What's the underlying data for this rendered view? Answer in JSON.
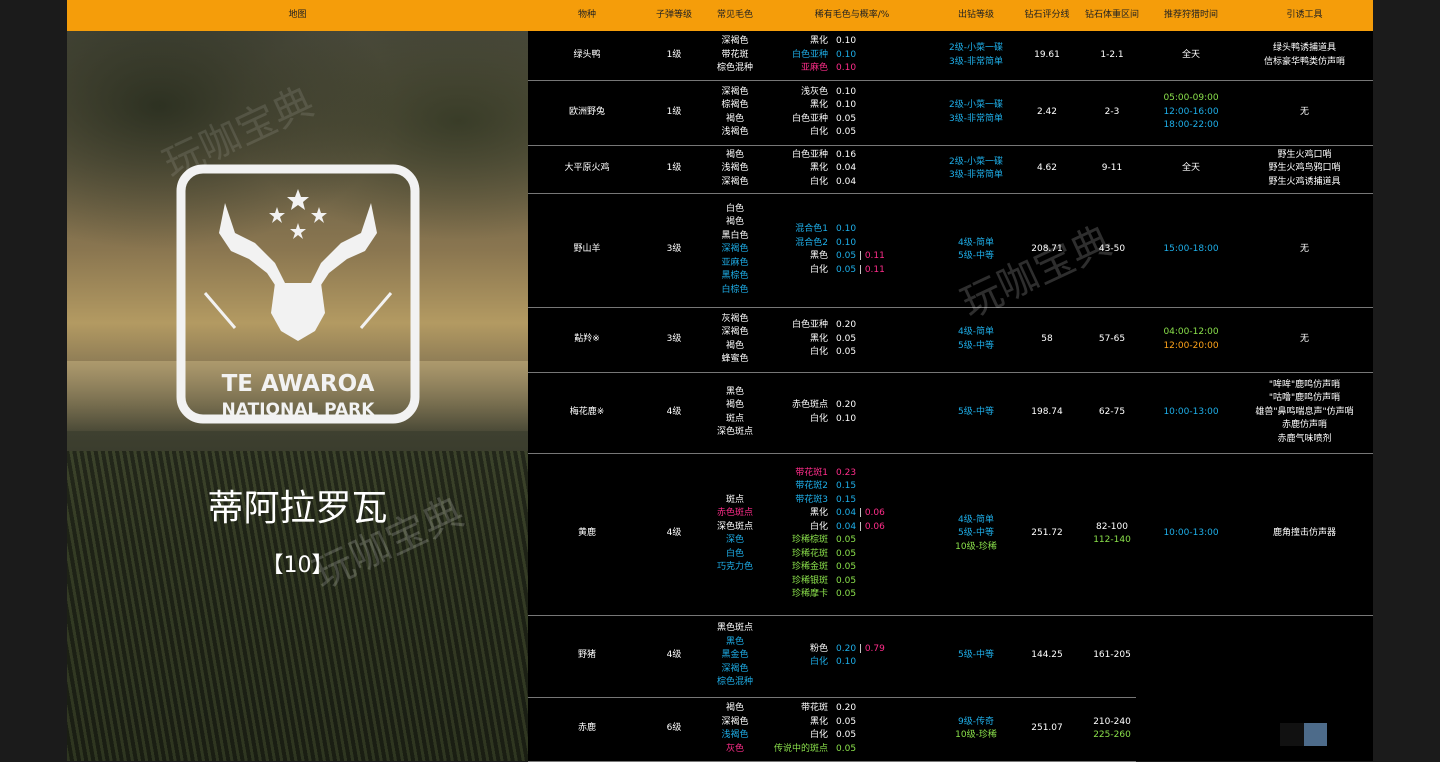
{
  "header": {
    "map": "地图",
    "species": "物种",
    "ammo": "子弹等级",
    "common": "常见毛色",
    "rare": "稀有毛色与概率/%",
    "diamond_level": "出钻等级",
    "score": "钻石评分线",
    "weight": "钻石体重区间",
    "time": "推荐狩猎时间",
    "lure": "引诱工具"
  },
  "left": {
    "park_line1": "TE AWAROA",
    "park_line2": "NATIONAL PARK",
    "name": "蒂阿拉罗瓦",
    "number": "【10】",
    "watermark": "玩咖宝典"
  },
  "table_watermark": "玩咖宝典",
  "rows": [
    {
      "species": "绿头鸭",
      "ammo": "1级",
      "common": [
        {
          "t": "深褐色",
          "c": "w"
        },
        {
          "t": "带花斑",
          "c": "w"
        },
        {
          "t": "棕色混种",
          "c": "w"
        }
      ],
      "rare": [
        {
          "n": "黑化",
          "nc": "w",
          "v": "0.10",
          "vc": "w"
        },
        {
          "n": "白色亚种",
          "nc": "b",
          "v": "0.10",
          "vc": "b"
        },
        {
          "n": "亚麻色",
          "nc": "p",
          "v": "0.10",
          "vc": "p"
        }
      ],
      "diamond": [
        {
          "t": "2级-小菜一碟",
          "c": "b"
        },
        {
          "t": "3级-非常简单",
          "c": "b"
        }
      ],
      "score": "19.61",
      "weight": [
        {
          "t": "1-2.1",
          "c": "w"
        }
      ],
      "time": [
        {
          "t": "全天",
          "c": "w"
        }
      ],
      "lure": [
        {
          "t": "绿头鸭诱捕道具",
          "c": "w"
        },
        {
          "t": "信标豪华鸭类仿声哨",
          "c": "w"
        }
      ]
    },
    {
      "species": "欧洲野兔",
      "ammo": "1级",
      "common": [
        {
          "t": "深褐色",
          "c": "w"
        },
        {
          "t": "棕褐色",
          "c": "w"
        },
        {
          "t": "褐色",
          "c": "w"
        },
        {
          "t": "浅褐色",
          "c": "w"
        }
      ],
      "rare": [
        {
          "n": "浅灰色",
          "nc": "w",
          "v": "0.10",
          "vc": "w"
        },
        {
          "n": "黑化",
          "nc": "w",
          "v": "0.10",
          "vc": "w"
        },
        {
          "n": "白色亚种",
          "nc": "w",
          "v": "0.05",
          "vc": "w"
        },
        {
          "n": "白化",
          "nc": "w",
          "v": "0.05",
          "vc": "w"
        }
      ],
      "diamond": [
        {
          "t": "2级-小菜一碟",
          "c": "b"
        },
        {
          "t": "3级-非常简单",
          "c": "b"
        }
      ],
      "score": "2.42",
      "weight": [
        {
          "t": "2-3",
          "c": "w"
        }
      ],
      "time": [
        {
          "t": "05:00-09:00",
          "c": "g"
        },
        {
          "t": "12:00-16:00",
          "c": "b"
        },
        {
          "t": "18:00-22:00",
          "c": "b"
        }
      ],
      "lure": [
        {
          "t": "无",
          "c": "w"
        }
      ]
    },
    {
      "species": "大平原火鸡",
      "ammo": "1级",
      "common": [
        {
          "t": "褐色",
          "c": "w"
        },
        {
          "t": "浅褐色",
          "c": "w"
        },
        {
          "t": "深褐色",
          "c": "w"
        }
      ],
      "rare": [
        {
          "n": "白色亚种",
          "nc": "w",
          "v": "0.16",
          "vc": "w"
        },
        {
          "n": "黑化",
          "nc": "w",
          "v": "0.04",
          "vc": "w"
        },
        {
          "n": "白化",
          "nc": "w",
          "v": "0.04",
          "vc": "w"
        }
      ],
      "diamond": [
        {
          "t": "2级-小菜一碟",
          "c": "b"
        },
        {
          "t": "3级-非常简单",
          "c": "b"
        }
      ],
      "score": "4.62",
      "weight": [
        {
          "t": "9-11",
          "c": "w"
        }
      ],
      "time": [
        {
          "t": "全天",
          "c": "w"
        }
      ],
      "lure": [
        {
          "t": "野生火鸡口哨",
          "c": "w"
        },
        {
          "t": "野生火鸡鸟鸦口哨",
          "c": "w"
        },
        {
          "t": "野生火鸡诱捕道具",
          "c": "w"
        }
      ]
    },
    {
      "species": "野山羊",
      "ammo": "3级",
      "common": [
        {
          "t": "白色",
          "c": "w"
        },
        {
          "t": "褐色",
          "c": "w"
        },
        {
          "t": "黑白色",
          "c": "w"
        },
        {
          "t": "深褐色",
          "c": "b"
        },
        {
          "t": "亚麻色",
          "c": "b"
        },
        {
          "t": "黑棕色",
          "c": "b"
        },
        {
          "t": "白棕色",
          "c": "b"
        }
      ],
      "rare": [
        {
          "n": "混合色1",
          "nc": "b",
          "v": "0.10",
          "vc": "b"
        },
        {
          "n": "混合色2",
          "nc": "b",
          "v": "0.10",
          "vc": "b"
        },
        {
          "n": "黑色",
          "nc": "w",
          "v": "0.05",
          "vc": "b",
          "v2": "0.11"
        },
        {
          "n": "白化",
          "nc": "w",
          "v": "0.05",
          "vc": "b",
          "v2": "0.11"
        }
      ],
      "diamond": [
        {
          "t": "4级-简单",
          "c": "b"
        },
        {
          "t": "5级-中等",
          "c": "b"
        }
      ],
      "score": "208.71",
      "weight": [
        {
          "t": "43-50",
          "c": "w"
        }
      ],
      "time": [
        {
          "t": "15:00-18:00",
          "c": "b"
        }
      ],
      "lure": [
        {
          "t": "无",
          "c": "w"
        }
      ]
    },
    {
      "species": "黇羚※",
      "ammo": "3级",
      "common": [
        {
          "t": "灰褐色",
          "c": "w"
        },
        {
          "t": "深褐色",
          "c": "w"
        },
        {
          "t": "褐色",
          "c": "w"
        },
        {
          "t": "蜂蜜色",
          "c": "w"
        }
      ],
      "rare": [
        {
          "n": "白色亚种",
          "nc": "w",
          "v": "0.20",
          "vc": "w"
        },
        {
          "n": "黑化",
          "nc": "w",
          "v": "0.05",
          "vc": "w"
        },
        {
          "n": "白化",
          "nc": "w",
          "v": "0.05",
          "vc": "w"
        }
      ],
      "diamond": [
        {
          "t": "4级-简单",
          "c": "b"
        },
        {
          "t": "5级-中等",
          "c": "b"
        }
      ],
      "score": "58",
      "weight": [
        {
          "t": "57-65",
          "c": "w"
        }
      ],
      "time": [
        {
          "t": "04:00-12:00",
          "c": "g"
        },
        {
          "t": "12:00-20:00",
          "c": "o"
        }
      ],
      "lure": [
        {
          "t": "无",
          "c": "w"
        }
      ]
    },
    {
      "species": "梅花鹿※",
      "ammo": "4级",
      "common": [
        {
          "t": "黑色",
          "c": "w"
        },
        {
          "t": "褐色",
          "c": "w"
        },
        {
          "t": "斑点",
          "c": "w"
        },
        {
          "t": "深色斑点",
          "c": "w"
        }
      ],
      "rare": [
        {
          "n": "赤色斑点",
          "nc": "w",
          "v": "0.20",
          "vc": "w"
        },
        {
          "n": "白化",
          "nc": "w",
          "v": "0.10",
          "vc": "w"
        }
      ],
      "diamond": [
        {
          "t": "5级-中等",
          "c": "b"
        }
      ],
      "score": "198.74",
      "weight": [
        {
          "t": "62-75",
          "c": "w"
        }
      ],
      "time": [
        {
          "t": "10:00-13:00",
          "c": "b"
        }
      ],
      "lure": [
        {
          "t": "\"哞哞\"鹿鸣仿声哨",
          "c": "w"
        },
        {
          "t": "\"咕噜\"鹿鸣仿声哨",
          "c": "w"
        },
        {
          "t": "雄兽\"鼻鸣喘息声\"仿声哨",
          "c": "w"
        },
        {
          "t": "赤鹿仿声哨",
          "c": "w"
        },
        {
          "t": "赤鹿气味喷剂",
          "c": "w"
        }
      ]
    },
    {
      "species": "黄鹿",
      "ammo": "4级",
      "common": [
        {
          "t": "斑点",
          "c": "w"
        },
        {
          "t": "赤色斑点",
          "c": "p"
        },
        {
          "t": "深色斑点",
          "c": "w"
        },
        {
          "t": "深色",
          "c": "b"
        },
        {
          "t": "白色",
          "c": "b"
        },
        {
          "t": "巧克力色",
          "c": "b"
        }
      ],
      "rare": [
        {
          "n": "带花斑1",
          "nc": "p",
          "v": "0.23",
          "vc": "p"
        },
        {
          "n": "带花斑2",
          "nc": "b",
          "v": "0.15",
          "vc": "b"
        },
        {
          "n": "带花斑3",
          "nc": "b",
          "v": "0.15",
          "vc": "b"
        },
        {
          "n": "黑化",
          "nc": "w",
          "v": "0.04",
          "vc": "b",
          "v2": "0.06"
        },
        {
          "n": "白化",
          "nc": "w",
          "v": "0.04",
          "vc": "b",
          "v2": "0.06"
        },
        {
          "n": "珍稀棕斑",
          "nc": "g",
          "v": "0.05",
          "vc": "g"
        },
        {
          "n": "珍稀花斑",
          "nc": "g",
          "v": "0.05",
          "vc": "g"
        },
        {
          "n": "珍稀金斑",
          "nc": "g",
          "v": "0.05",
          "vc": "g"
        },
        {
          "n": "珍稀银斑",
          "nc": "g",
          "v": "0.05",
          "vc": "g"
        },
        {
          "n": "珍稀摩卡",
          "nc": "g",
          "v": "0.05",
          "vc": "g"
        }
      ],
      "diamond": [
        {
          "t": "4级-简单",
          "c": "b"
        },
        {
          "t": "5级-中等",
          "c": "b"
        },
        {
          "t": "10级-珍稀",
          "c": "g"
        }
      ],
      "score": "251.72",
      "weight": [
        {
          "t": "82-100",
          "c": "w"
        },
        {
          "t": "112-140",
          "c": "g"
        }
      ],
      "time": [
        {
          "t": "10:00-13:00",
          "c": "b"
        }
      ],
      "lure": [
        {
          "t": "鹿角撞击仿声器",
          "c": "w"
        }
      ]
    },
    {
      "species": "野猪",
      "ammo": "4级",
      "common": [
        {
          "t": "黑色斑点",
          "c": "w"
        },
        {
          "t": "黑色",
          "c": "b"
        },
        {
          "t": "黑金色",
          "c": "b"
        },
        {
          "t": "深褐色",
          "c": "b"
        },
        {
          "t": "棕色混种",
          "c": "b"
        }
      ],
      "rare": [
        {
          "n": "粉色",
          "nc": "w",
          "v": "0.20",
          "vc": "b",
          "v2": "0.79"
        },
        {
          "n": "白化",
          "nc": "b",
          "v": "0.10",
          "vc": "b"
        }
      ],
      "diamond": [
        {
          "t": "5级-中等",
          "c": "b"
        }
      ],
      "score": "144.25",
      "weight": [
        {
          "t": "161-205",
          "c": "w"
        }
      ],
      "time": [],
      "lure": []
    },
    {
      "species": "赤鹿",
      "ammo": "6级",
      "common": [
        {
          "t": "褐色",
          "c": "w"
        },
        {
          "t": "深褐色",
          "c": "w"
        },
        {
          "t": "浅褐色",
          "c": "b"
        },
        {
          "t": "灰色",
          "c": "p"
        }
      ],
      "rare": [
        {
          "n": "带花斑",
          "nc": "w",
          "v": "0.20",
          "vc": "w"
        },
        {
          "n": "黑化",
          "nc": "w",
          "v": "0.05",
          "vc": "w"
        },
        {
          "n": "白化",
          "nc": "w",
          "v": "0.05",
          "vc": "w"
        },
        {
          "n": "传说中的斑点",
          "nc": "g",
          "v": "0.05",
          "vc": "g"
        }
      ],
      "diamond": [
        {
          "t": "9级-传奇",
          "c": "b"
        },
        {
          "t": "10级-珍稀",
          "c": "g"
        }
      ],
      "score": "251.07",
      "weight": [
        {
          "t": "210-240",
          "c": "w"
        },
        {
          "t": "225-260",
          "c": "g"
        }
      ],
      "time": [],
      "lure": []
    }
  ]
}
